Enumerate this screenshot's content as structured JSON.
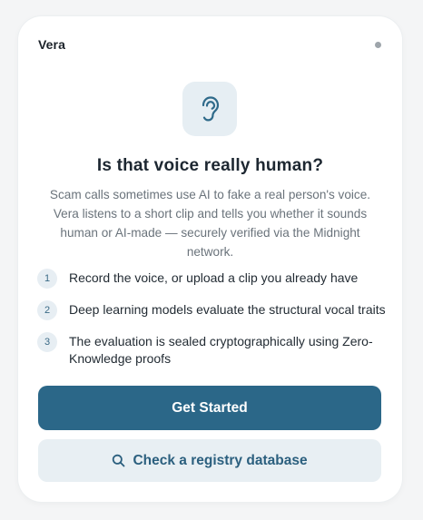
{
  "header": {
    "brand": "Vera"
  },
  "hero": {
    "icon": "ear-icon",
    "title": "Is that voice really human?",
    "description": "Scam calls sometimes use AI to fake a real person's voice. Vera listens to a short clip and tells you whether it sounds human or AI-made — securely verified via the Midnight network."
  },
  "steps": [
    {
      "number": "1",
      "text": "Record the voice, or upload a clip you already have"
    },
    {
      "number": "2",
      "text": "Deep learning models evaluate the structural vocal traits"
    },
    {
      "number": "3",
      "text": "The evaluation is sealed cryptographically using Zero-Knowledge proofs"
    }
  ],
  "actions": {
    "primary_label": "Get Started",
    "secondary_label": "Check a registry database",
    "secondary_icon": "search-icon"
  },
  "colors": {
    "primary": "#2b6788",
    "secondary_bg": "#e8eff3",
    "accent_text": "#2b5f7e"
  }
}
